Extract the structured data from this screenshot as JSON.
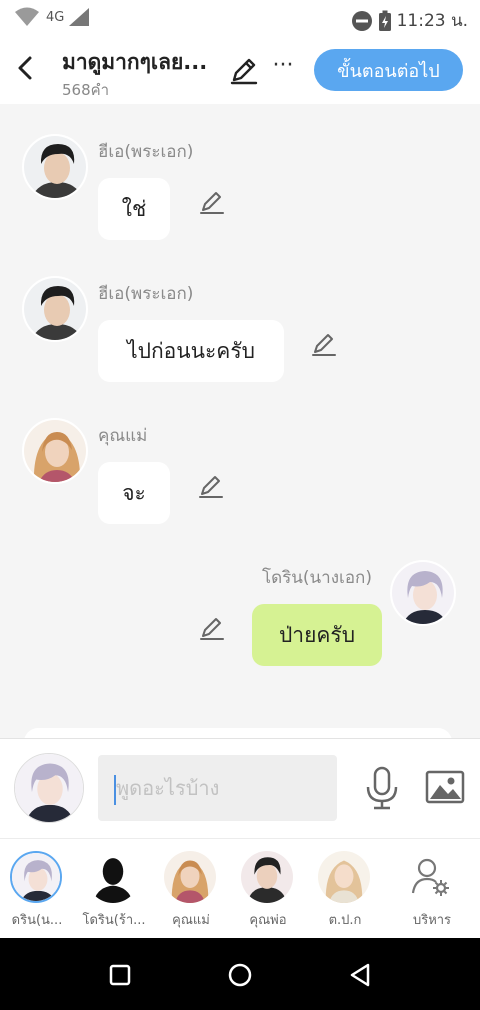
{
  "status_bar": {
    "network": "4G",
    "time": "11:23 น."
  },
  "header": {
    "title": "มาดูมากๆเลย...",
    "word_count": "568คำ",
    "more_label": "···",
    "next_label": "ขั้นตอนต่อไป"
  },
  "messages": [
    {
      "sender": "ฮีเอ(พระเอก)",
      "text": "ใช่",
      "side": "left",
      "avatar": "man-dark-hair"
    },
    {
      "sender": "ฮีเอ(พระเอก)",
      "text": "ไปก่อนนะครับ",
      "side": "left",
      "avatar": "man-dark-hair"
    },
    {
      "sender": "คุณแม่",
      "text": "จะ",
      "side": "left",
      "avatar": "woman-blonde"
    },
    {
      "sender": "โดริน(นางเอก)",
      "text": "ป่ายครับ",
      "side": "right",
      "avatar": "silver-hair"
    }
  ],
  "input": {
    "placeholder": "พูดอะไรบ้าง",
    "value": ""
  },
  "characters": [
    {
      "label": "ดริน(น...",
      "avatar": "silver-hair",
      "selected": true
    },
    {
      "label": "โดริน(ร้า...",
      "avatar": "silhouette",
      "selected": false
    },
    {
      "label": "คุณแม่",
      "avatar": "woman-blonde",
      "selected": false
    },
    {
      "label": "คุณพ่อ",
      "avatar": "man-dark-hair",
      "selected": false
    },
    {
      "label": "ต.ป.ก",
      "avatar": "woman-light",
      "selected": false
    },
    {
      "label": "บริหาร",
      "avatar": "manage-icon",
      "selected": false
    }
  ],
  "colors": {
    "accent": "#5aa7f0",
    "my_bubble": "#d6f293",
    "background": "#f5f5f5"
  }
}
